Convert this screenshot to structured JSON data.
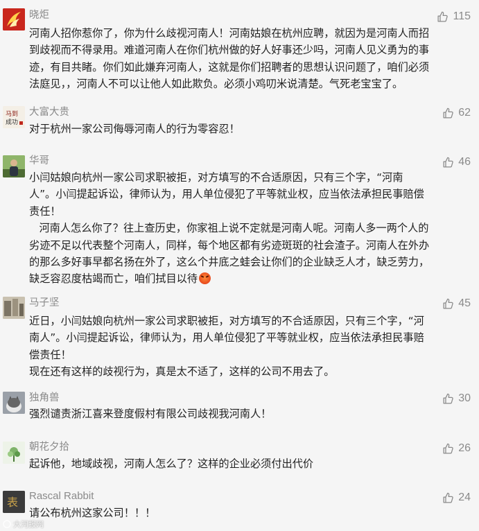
{
  "comments": [
    {
      "author": "晓炬",
      "likes": "115",
      "lines": [
        "河南人招你惹你了，你为什么歧视河南人！河南姑娘在杭州应聘，就因为是河南人而招",
        "到歧视而不得录用。难道河南人在你们杭州做的好人好事还少吗，河南人见义勇为的事",
        "迹，有目共睹。你们如此嫌弃河南人，这就是你们招聘者的思想认识问题了，咱们必须",
        "法庭见，，河南人不可以让他人如此欺负。必须小鸡叨米说清楚。气死老宝宝了。"
      ]
    },
    {
      "author": "大富大贵",
      "likes": "62",
      "lines": [
        "对于杭州一家公司侮辱河南人的行为零容忍！"
      ]
    },
    {
      "author": "华哥",
      "likes": "46",
      "lines": [
        "小闫姑娘向杭州一家公司求职被拒，对方填写的不合适原因，只有三个字，“河南",
        "人”。小闫提起诉讼，律师认为，用人单位侵犯了平等就业权，应当依法承担民事赔偿",
        "责任！",
        "   河南人怎么你了？往上查历史，你家祖上说不定就是河南人呢。河南人多一两个人的",
        "劣迹不足以代表整个河南人，同样，每个地区都有劣迹斑斑的社会渣子。河南人在外办",
        "的那么多好事早都名扬在外了，这么个井底之蛙会让你们的企业缺乏人才，缺乏劳力，",
        "缺乏容忍度枯竭而亡，咱们拭目以待"
      ]
    },
    {
      "author": "马子坚",
      "likes": "45",
      "lines": [
        "近日，小闫姑娘向杭州一家公司求职被拒，对方填写的不合适原因，只有三个字，“河",
        "南人”。小闫提起诉讼，律师认为，用人单位侵犯了平等就业权，应当依法承担民事赔",
        "偿责任！",
        "现在还有这样的歧视行为，真是太不适了，这样的公司不用去了。"
      ]
    },
    {
      "author": "独角兽",
      "likes": "30",
      "lines": [
        "强烈谴责浙江喜来登度假村有限公司歧视我河南人！"
      ]
    },
    {
      "author": "朝花夕拾",
      "likes": "26",
      "lines": [
        "起诉他，地域歧视，河南人怎么了？这样的企业必须付出代价"
      ]
    },
    {
      "author": "Rascal Rabbit",
      "likes": "24",
      "lines": [
        "请公布杭州这家公司！！！"
      ]
    }
  ],
  "icons": {
    "like": "thumbs-up-icon",
    "emoji": "angry-face-icon"
  },
  "watermark": "大河报网",
  "colors": {
    "background": "#f5f5f5",
    "meta_text": "#8a8a8a",
    "body_text": "#222222"
  }
}
